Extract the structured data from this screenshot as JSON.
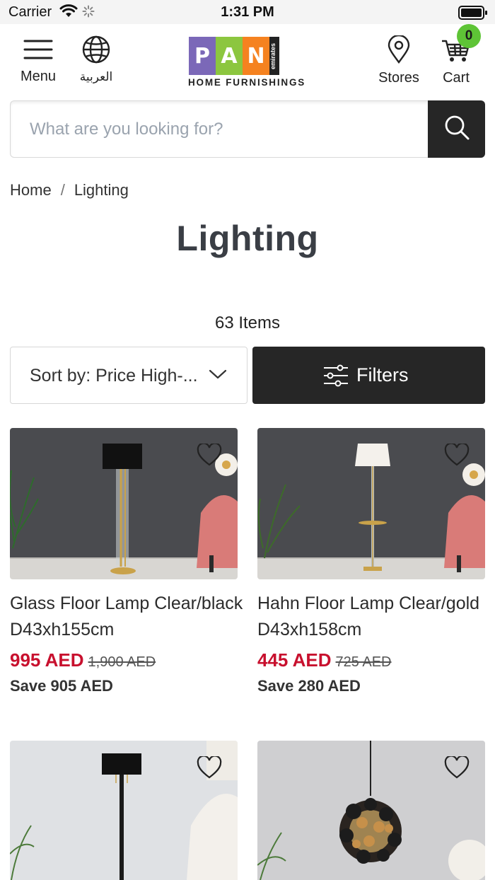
{
  "status_bar": {
    "carrier": "Carrier",
    "time": "1:31 PM"
  },
  "header": {
    "menu_label": "Menu",
    "language_label": "العربية",
    "stores_label": "Stores",
    "cart_label": "Cart",
    "cart_count": "0",
    "logo": {
      "letters": [
        "P",
        "A",
        "N"
      ],
      "side_text": "emirates",
      "subtitle": "HOME FURNISHINGS",
      "colors": [
        "#7b68b8",
        "#8cc63f",
        "#f58220"
      ]
    }
  },
  "search": {
    "placeholder": "What are you looking for?",
    "value": ""
  },
  "breadcrumb": {
    "home": "Home",
    "separator": "/",
    "current": "Lighting"
  },
  "page_title": "Lighting",
  "item_count": "63 Items",
  "sort": {
    "label": "Sort by: Price High-..."
  },
  "filters": {
    "label": "Filters"
  },
  "products": [
    {
      "name": "Glass Floor Lamp Clear/black D43xh155cm",
      "price": "995 AED",
      "was": "1,900 AED",
      "save": "Save 905 AED"
    },
    {
      "name": "Hahn Floor Lamp Clear/gold D43xh158cm",
      "price": "445 AED",
      "was": "725 AED",
      "save": "Save 280 AED"
    },
    {
      "name": "",
      "price": "",
      "was": "",
      "save": ""
    },
    {
      "name": "",
      "price": "",
      "was": "",
      "save": ""
    }
  ],
  "colors": {
    "accent_dark": "#262626",
    "sale_red": "#c8102e",
    "badge_green": "#5ec436"
  }
}
